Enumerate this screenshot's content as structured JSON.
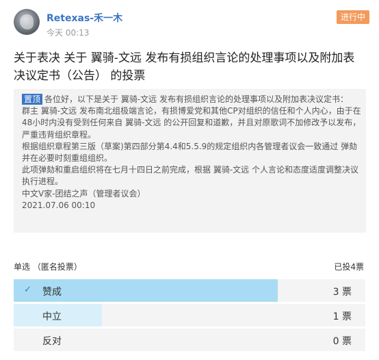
{
  "post": {
    "username": "Retexas-禾一木",
    "time": "今天 00:13",
    "status": "进行中",
    "title": "关于表决 关于 翼骑-文远 发布有损组织言论的处理事项以及附加表决议定书（公告） 的投票"
  },
  "content": {
    "pin_tag": "置顶",
    "paragraphs": [
      "各位好，以下是关于 翼骑-文远 发布有损组织言论的处理事项以及附加表决议定书：",
      "群主 翼骑-文远 发布南北组极端言论，有损博爱党和其他CP对组织的信任和个人内心，由于在48小时内没有受到任何来自 翼骑-文远 的公开回复和道歉，并且对原歌词不加修改予以发布，严重违背组织章程。",
      "根据组织章程第三版（草案)第四部分第4.4和5.5.9的规定组织内各管理者议会一致通过 弹劾 并在必要时刻重组组织。",
      "此项弹劾和重启组织将在七月十四日之前完成，根据 翼骑-文远 个人言论和态度适度调整决议执行进程。",
      "中文V家-团结之声（管理者议会）",
      "2021.07.06 00:10"
    ]
  },
  "vote": {
    "type_label": "单选 （匿名投票）",
    "total_label": "已投4票",
    "options": [
      {
        "label": "赞成",
        "count": "3 票",
        "checked": true,
        "share": 0.75,
        "fill_color": "#a9dcf4"
      },
      {
        "label": "中立",
        "count": "1 票",
        "checked": false,
        "share": 0.25,
        "fill_color": "#d9f0fb"
      },
      {
        "label": "反对",
        "count": "0 票",
        "checked": false,
        "share": 0,
        "fill_color": "#d9f0fb"
      }
    ]
  },
  "colors": {
    "accent": "#3a75c4",
    "status": "#f39b5c"
  }
}
